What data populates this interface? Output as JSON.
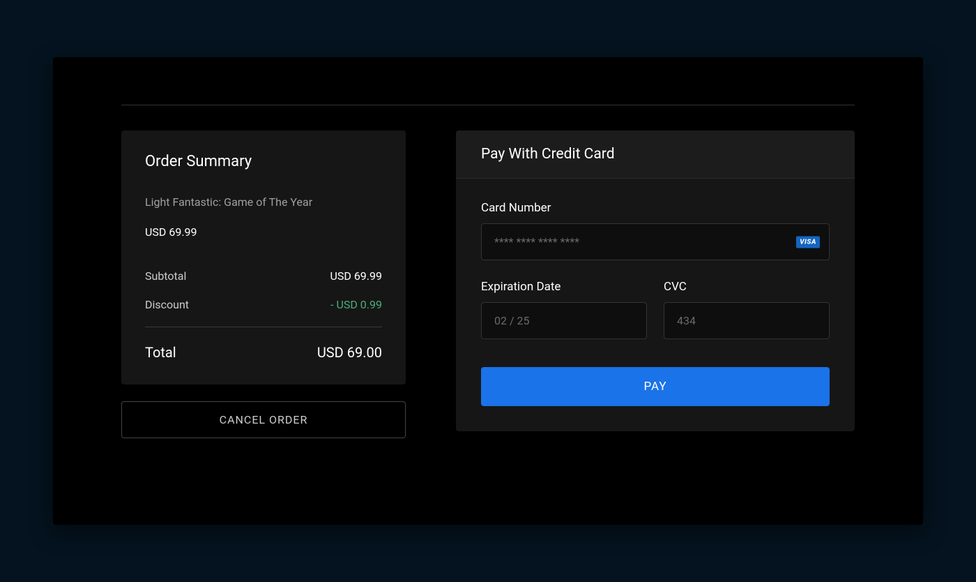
{
  "summary": {
    "title": "Order Summary",
    "product_name": "Light Fantastic: Game of The Year",
    "product_price": "USD 69.99",
    "subtotal_label": "Subtotal",
    "subtotal_value": "USD 69.99",
    "discount_label": "Discount",
    "discount_value": "- USD 0.99",
    "total_label": "Total",
    "total_value": "USD 69.00"
  },
  "cancel_button": "CANCEL ORDER",
  "payment": {
    "title": "Pay With Credit Card",
    "card_number_label": "Card Number",
    "card_number_placeholder": "**** **** **** ****",
    "card_brand": "VISA",
    "expiration_label": "Expiration Date",
    "expiration_placeholder": "02 / 25",
    "cvc_label": "CVC",
    "cvc_placeholder": "434",
    "pay_button": "PAY"
  }
}
